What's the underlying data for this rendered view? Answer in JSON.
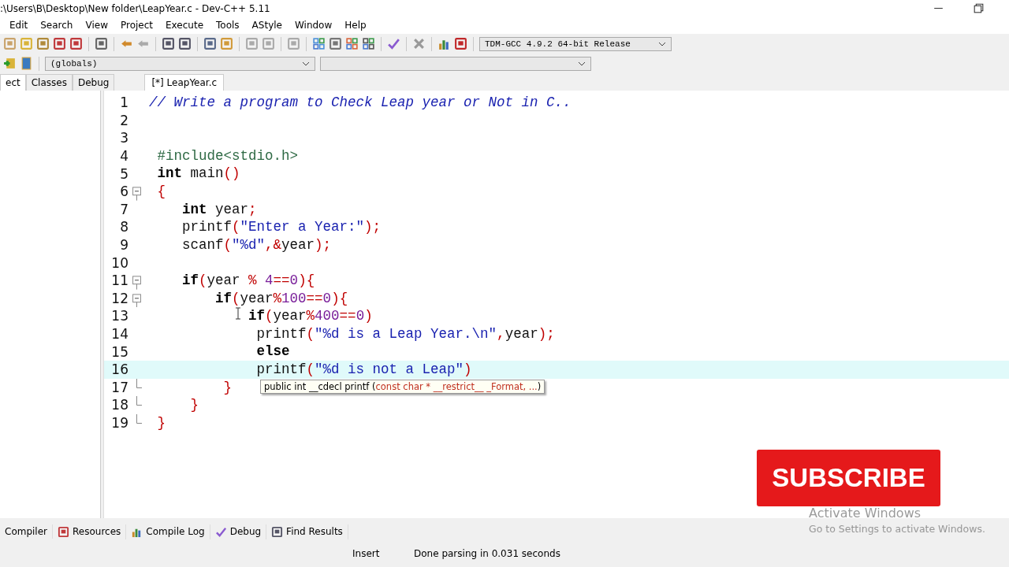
{
  "window": {
    "title": ":\\Users\\B\\Desktop\\New folder\\LeapYear.c - Dev-C++ 5.11"
  },
  "menu": [
    "Edit",
    "Search",
    "View",
    "Project",
    "Execute",
    "Tools",
    "AStyle",
    "Window",
    "Help"
  ],
  "compiler_select": {
    "value": "TDM-GCC 4.9.2 64-bit Release"
  },
  "scope_select": {
    "value": "(globals)"
  },
  "side_tabs": [
    {
      "label": "ect",
      "selected": true
    },
    {
      "label": "Classes",
      "selected": false
    },
    {
      "label": "Debug",
      "selected": false
    }
  ],
  "editor_tabs": [
    {
      "label": "[*] LeapYear.c",
      "selected": true
    }
  ],
  "code": [
    {
      "number": "1",
      "current": false,
      "collapsible": false,
      "block_end": false,
      "tokens": [
        {
          "kind": "comment",
          "text": "// Write a program to Check Leap year or Not in C.."
        }
      ]
    },
    {
      "number": "2",
      "current": false,
      "collapsible": false,
      "block_end": false
    },
    {
      "number": "3",
      "current": false,
      "collapsible": false,
      "block_end": false
    },
    {
      "number": "4",
      "current": false,
      "collapsible": false,
      "block_end": false,
      "tokens": [
        {
          "kind": "preprocessor",
          "text": " #include<stdio.h>"
        }
      ]
    },
    {
      "number": "5",
      "current": false,
      "collapsible": false,
      "block_end": false,
      "tokens": [
        {
          "kind": "keyword",
          "text": " int"
        },
        {
          "kind": "plain",
          "text": " main"
        },
        {
          "kind": "symbol",
          "text": "()"
        }
      ]
    },
    {
      "number": "6",
      "current": false,
      "collapsible": true,
      "block_end": false,
      "tokens": [
        {
          "kind": "symbol",
          "text": " {"
        }
      ]
    },
    {
      "number": "7",
      "current": false,
      "collapsible": false,
      "block_end": false,
      "tokens": [
        {
          "kind": "keyword",
          "text": "    int"
        },
        {
          "kind": "plain",
          "text": " year"
        },
        {
          "kind": "symbol",
          "text": ";"
        }
      ]
    },
    {
      "number": "8",
      "current": false,
      "collapsible": false,
      "block_end": false,
      "tokens": [
        {
          "kind": "plain",
          "text": "    printf"
        },
        {
          "kind": "symbol",
          "text": "("
        },
        {
          "kind": "string",
          "text": "\"Enter a Year:\""
        },
        {
          "kind": "symbol",
          "text": ");"
        }
      ]
    },
    {
      "number": "9",
      "current": false,
      "collapsible": false,
      "block_end": false,
      "tokens": [
        {
          "kind": "plain",
          "text": "    scanf"
        },
        {
          "kind": "symbol",
          "text": "("
        },
        {
          "kind": "string",
          "text": "\"%d\""
        },
        {
          "kind": "symbol",
          "text": ",&"
        },
        {
          "kind": "plain",
          "text": "year"
        },
        {
          "kind": "symbol",
          "text": ");"
        }
      ]
    },
    {
      "number": "10",
      "current": false,
      "collapsible": false,
      "block_end": false
    },
    {
      "number": "11",
      "current": false,
      "collapsible": true,
      "block_end": false,
      "tokens": [
        {
          "kind": "keyword",
          "text": "    if"
        },
        {
          "kind": "symbol",
          "text": "("
        },
        {
          "kind": "plain",
          "text": "year "
        },
        {
          "kind": "symbol",
          "text": "% "
        },
        {
          "kind": "number",
          "text": "4"
        },
        {
          "kind": "symbol",
          "text": "=="
        },
        {
          "kind": "number",
          "text": "0"
        },
        {
          "kind": "symbol",
          "text": "){"
        }
      ]
    },
    {
      "number": "12",
      "current": false,
      "collapsible": true,
      "block_end": false,
      "tokens": [
        {
          "kind": "keyword",
          "text": "        if"
        },
        {
          "kind": "symbol",
          "text": "("
        },
        {
          "kind": "plain",
          "text": "year"
        },
        {
          "kind": "symbol",
          "text": "%"
        },
        {
          "kind": "number",
          "text": "100"
        },
        {
          "kind": "symbol",
          "text": "=="
        },
        {
          "kind": "number",
          "text": "0"
        },
        {
          "kind": "symbol",
          "text": "){"
        }
      ]
    },
    {
      "number": "13",
      "current": false,
      "collapsible": false,
      "block_end": false,
      "tokens": [
        {
          "kind": "keyword",
          "text": "            if"
        },
        {
          "kind": "symbol",
          "text": "("
        },
        {
          "kind": "plain",
          "text": "year"
        },
        {
          "kind": "symbol",
          "text": "%"
        },
        {
          "kind": "number",
          "text": "400"
        },
        {
          "kind": "symbol",
          "text": "=="
        },
        {
          "kind": "number",
          "text": "0"
        },
        {
          "kind": "symbol",
          "text": ")"
        }
      ]
    },
    {
      "number": "14",
      "current": false,
      "collapsible": false,
      "block_end": false,
      "tokens": [
        {
          "kind": "plain",
          "text": "             printf"
        },
        {
          "kind": "symbol",
          "text": "("
        },
        {
          "kind": "string",
          "text": "\"%d is a Leap Year.\\n\""
        },
        {
          "kind": "symbol",
          "text": ","
        },
        {
          "kind": "plain",
          "text": "year"
        },
        {
          "kind": "symbol",
          "text": ");"
        }
      ]
    },
    {
      "number": "15",
      "current": false,
      "collapsible": false,
      "block_end": false,
      "tokens": [
        {
          "kind": "keyword",
          "text": "             else"
        }
      ]
    },
    {
      "number": "16",
      "current": true,
      "collapsible": false,
      "block_end": false,
      "tokens": [
        {
          "kind": "plain",
          "text": "             printf"
        },
        {
          "kind": "symbol",
          "text": "("
        },
        {
          "kind": "string",
          "text": "\"%d is not a Leap\""
        },
        {
          "kind": "symbol",
          "text": ")"
        }
      ]
    },
    {
      "number": "17",
      "current": false,
      "collapsible": false,
      "block_end": true,
      "tokens": [
        {
          "kind": "symbol",
          "text": "         }"
        }
      ]
    },
    {
      "number": "18",
      "current": false,
      "collapsible": false,
      "block_end": true,
      "tokens": [
        {
          "kind": "symbol",
          "text": "     }"
        }
      ]
    },
    {
      "number": "19",
      "current": false,
      "collapsible": false,
      "block_end": true,
      "tokens": [
        {
          "kind": "symbol",
          "text": " }"
        }
      ]
    }
  ],
  "hint": {
    "signature": "public int __cdecl printf (",
    "params": "const char * __restrict__ _Format, ...",
    "close": ")"
  },
  "bottom_tabs": [
    {
      "label": "Compiler"
    },
    {
      "label": "Resources"
    },
    {
      "label": "Compile Log"
    },
    {
      "label": "Debug"
    },
    {
      "label": "Find Results"
    }
  ],
  "status_bar": {
    "mode": "Insert",
    "message": "Done parsing in 0.031 seconds"
  },
  "subscribe": {
    "label": "SUBSCRIBE"
  },
  "activation": {
    "title": "Activate Windows",
    "text": "Go to Settings to activate Windows."
  }
}
